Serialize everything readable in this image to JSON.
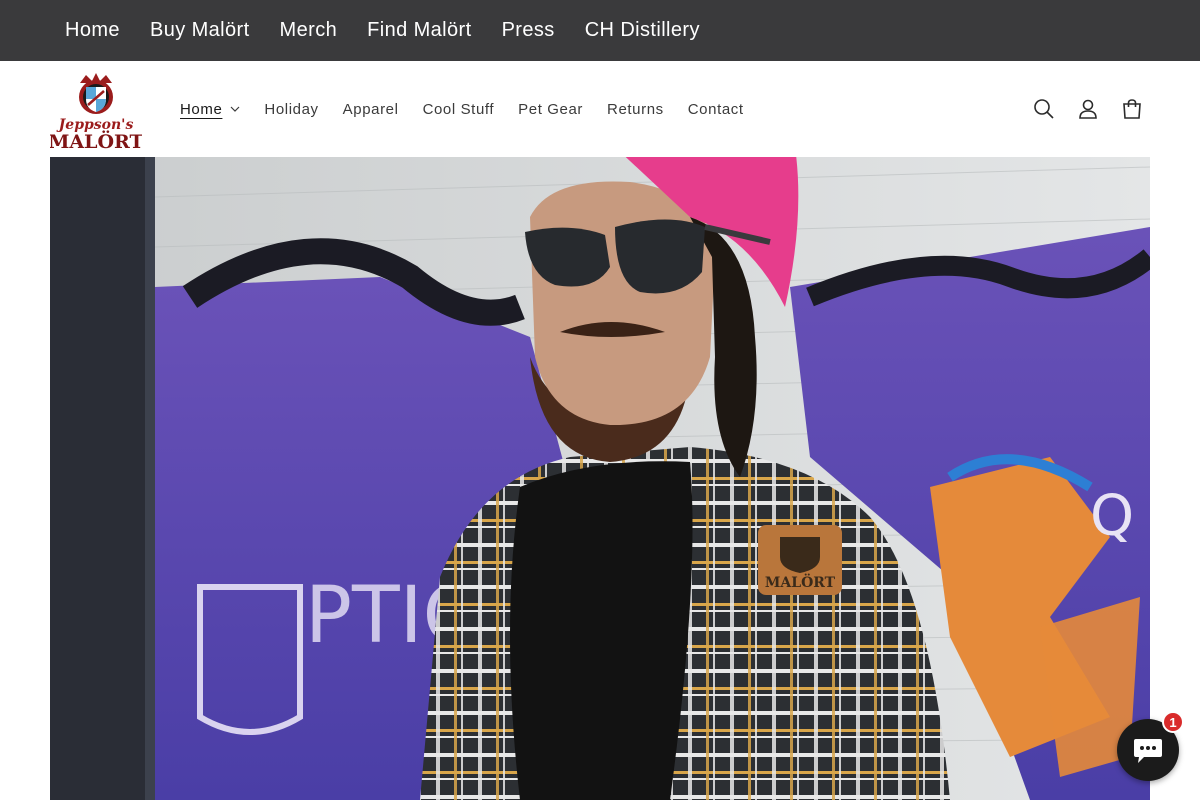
{
  "topnav": {
    "items": [
      "Home",
      "Buy Malört",
      "Merch",
      "Find Malört",
      "Press",
      "CH Distillery"
    ]
  },
  "header": {
    "logo": {
      "line1": "Jeppson's",
      "line2": "MALÖRT",
      "icon": "crest-logo"
    },
    "nav": [
      {
        "label": "Home",
        "active": true,
        "has_dropdown": true
      },
      {
        "label": "Holiday"
      },
      {
        "label": "Apparel"
      },
      {
        "label": "Cool Stuff"
      },
      {
        "label": "Pet Gear"
      },
      {
        "label": "Returns"
      },
      {
        "label": "Contact"
      }
    ],
    "icons": [
      "search-icon",
      "account-icon",
      "cart-icon"
    ]
  },
  "hero": {
    "image": "man-in-flannel-shirt-pink-beanie-sunglasses-graffiti-wall",
    "shirt_patch_text": "MALÖRT"
  },
  "chat": {
    "badge_count": "1",
    "icon": "chat-bubble-icon"
  },
  "colors": {
    "topbar_bg": "#3a3a3c",
    "brand_red": "#9b1c1c",
    "chat_bg": "#1b1b1b",
    "badge_red": "#d92b2b"
  }
}
